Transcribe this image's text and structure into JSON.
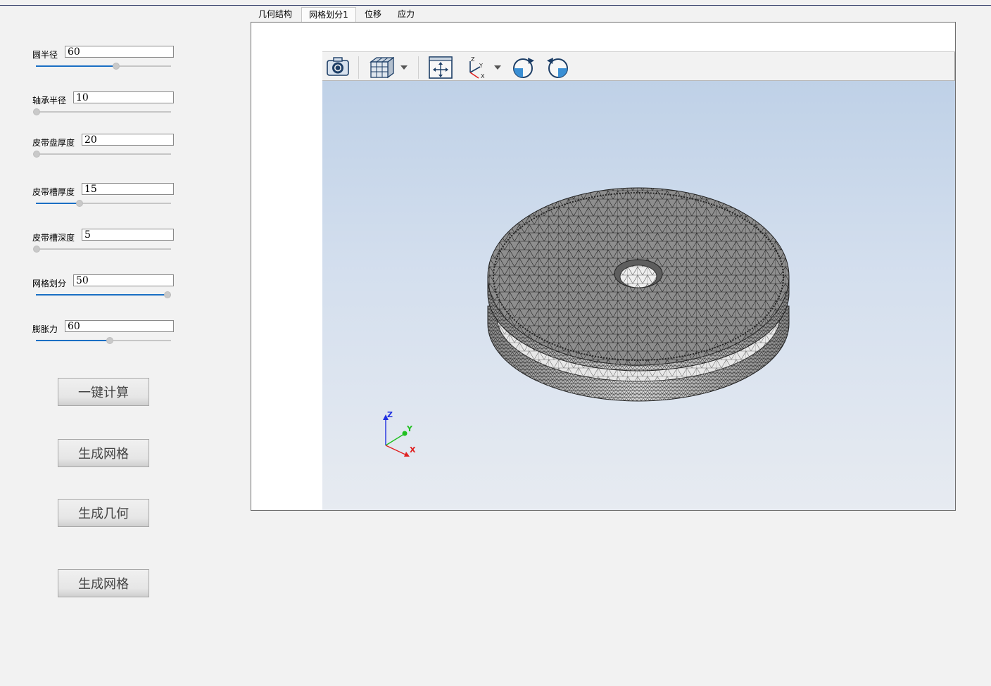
{
  "params": [
    {
      "label": "圆半径",
      "value": "60",
      "level": 0.61
    },
    {
      "label": "轴承半径",
      "value": "10",
      "level": 0.0
    },
    {
      "label": "皮带盘厚度",
      "value": "20",
      "level": 0.0
    },
    {
      "label": "皮带槽厚度",
      "value": "15",
      "level": 0.33
    },
    {
      "label": "皮带槽深度",
      "value": "5",
      "level": 0.0
    },
    {
      "label": "网格划分",
      "value": "50",
      "level": 1.0
    },
    {
      "label": "膨胀力",
      "value": "60",
      "level": 0.56
    }
  ],
  "buttons": [
    "一键计算",
    "生成网格",
    "生成几何",
    "生成网格"
  ],
  "tabs": [
    "几何结构",
    "网格划分1",
    "位移",
    "应力"
  ],
  "active_tab": "网格划分1",
  "toolbar": {
    "icons": [
      "camera-icon",
      "cube-view-icon",
      "chevron-down-icon",
      "fit-view-icon",
      "axes-icon",
      "chevron-down-icon",
      "rotate-cw-icon",
      "rotate-ccw-icon"
    ]
  },
  "triad": {
    "x": "X",
    "y": "Y",
    "z": "Z"
  },
  "colors": {
    "slider_fill": "#1a6fc4",
    "viewport_top": "#bfd1e7",
    "viewport_bottom": "#e7ebf1",
    "axis_x": "#e02020",
    "axis_y": "#20c020",
    "axis_z": "#2030e0"
  }
}
